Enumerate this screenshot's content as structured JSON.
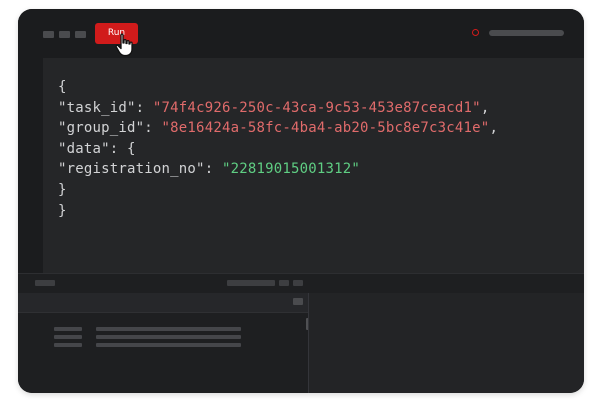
{
  "toolbar": {
    "run_label": "Run"
  },
  "icons": {
    "cursor": "hand-pointer-icon",
    "status": "status-circle-icon"
  },
  "colors": {
    "accent": "#d11b1b",
    "string_id": "#e06b6b",
    "string_value": "#5fce83"
  },
  "editor": {
    "lines": [
      "{",
      "\"task_id\": ",
      "\"74f4c926-250c-43ca-9c53-453e87ceacd1\"",
      ",",
      "\"group_id\": ",
      "\"8e16424a-58fc-4ba4-ab20-5bc8e7c3c41e\"",
      ",",
      "\"data\": {",
      "\"registration_no\": ",
      "\"22819015001312\"",
      "}",
      "}"
    ]
  }
}
